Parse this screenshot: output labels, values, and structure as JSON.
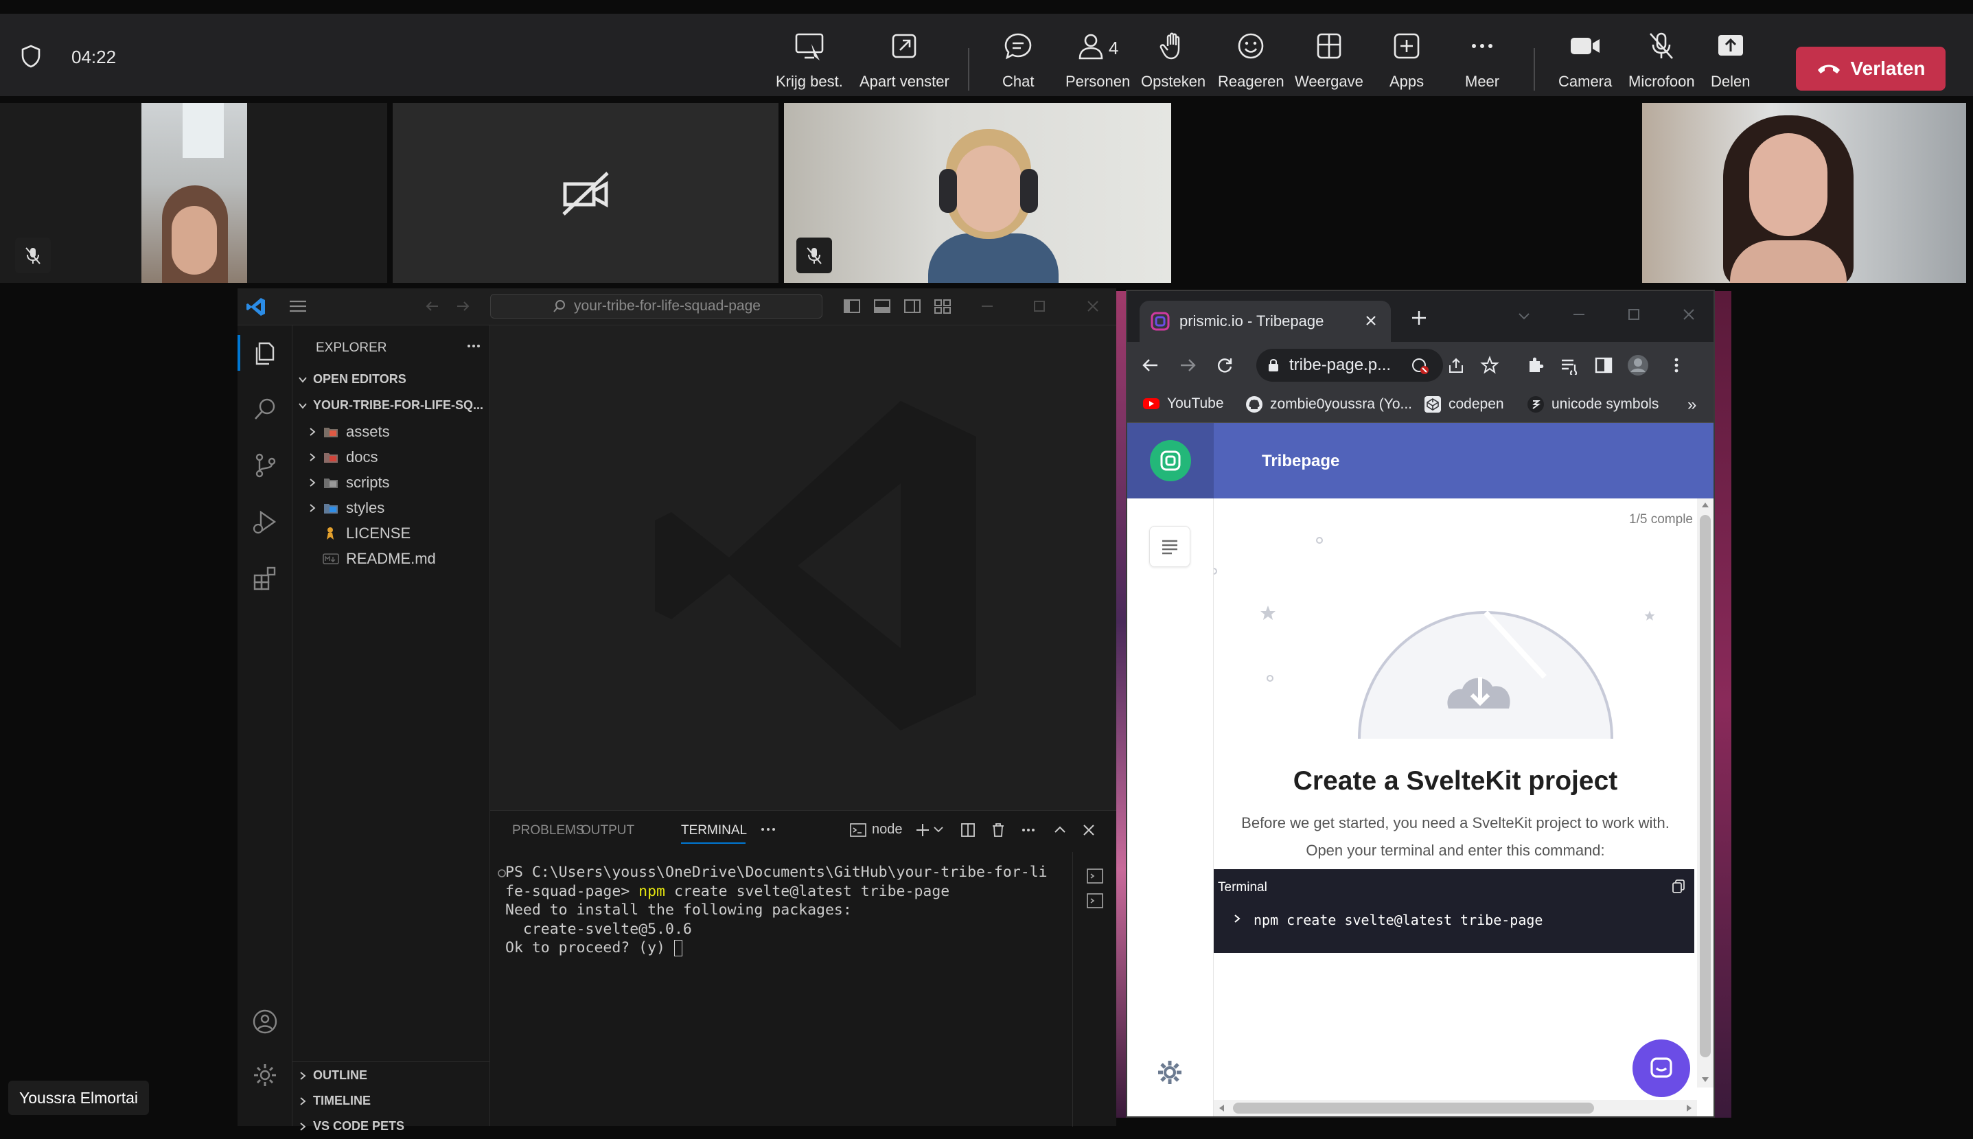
{
  "meeting": {
    "timer": "04:22",
    "buttons": {
      "spotlight": "Krijg best.",
      "popout": "Apart venster",
      "chat": "Chat",
      "people": "Personen",
      "people_count": "4",
      "raise_hand": "Opsteken",
      "react": "Reageren",
      "view": "Weergave",
      "apps": "Apps",
      "more": "Meer",
      "camera": "Camera",
      "mic": "Microfoon",
      "share": "Delen"
    },
    "leave": "Verlaten",
    "leave_color": "#c4314b",
    "participant_name": "Youssra Elmortai"
  },
  "vscode": {
    "search": "your-tribe-for-life-squad-page",
    "explorer_title": "EXPLORER",
    "open_editors": "OPEN EDITORS",
    "project": "YOUR-TRIBE-FOR-LIFE-SQ...",
    "tree": [
      {
        "name": "assets",
        "type": "folder"
      },
      {
        "name": "docs",
        "type": "folder"
      },
      {
        "name": "scripts",
        "type": "folder"
      },
      {
        "name": "styles",
        "type": "folder"
      },
      {
        "name": "LICENSE",
        "type": "file"
      },
      {
        "name": "README.md",
        "type": "file"
      }
    ],
    "sections": [
      "OUTLINE",
      "TIMELINE",
      "VS CODE PETS"
    ],
    "panel_tabs": [
      "PROBLEMS",
      "OUTPUT",
      "TERMINAL"
    ],
    "terminal_name": "node",
    "terminal": {
      "line1": "PS C:\\Users\\youss\\OneDrive\\Documents\\GitHub\\your-tribe-for-li",
      "line2_prefix": "fe-squad-page> ",
      "line2_cmd": "npm",
      "line2_rest": " create svelte@latest tribe-page",
      "line3": "Need to install the following packages:",
      "line4": "  create-svelte@5.0.6",
      "line5": "Ok to proceed? (y) "
    }
  },
  "browser": {
    "tab_title": "prismic.io - Tribepage",
    "url": "tribe-page.p...",
    "bookmarks": [
      "YouTube",
      "zombie0youssra (Yo...",
      "codepen",
      "unicode symbols"
    ],
    "brand_color": "#5163ba"
  },
  "prismic": {
    "repo_name": "Tribepage",
    "progress": "1/5 comple",
    "title": "Create a SvelteKit project",
    "desc1": "Before we get started, you need a SvelteKit project to work with.",
    "desc2": "Open your terminal and enter this command:",
    "terminal_label": "Terminal",
    "command": "npm create svelte@latest tribe-page"
  }
}
